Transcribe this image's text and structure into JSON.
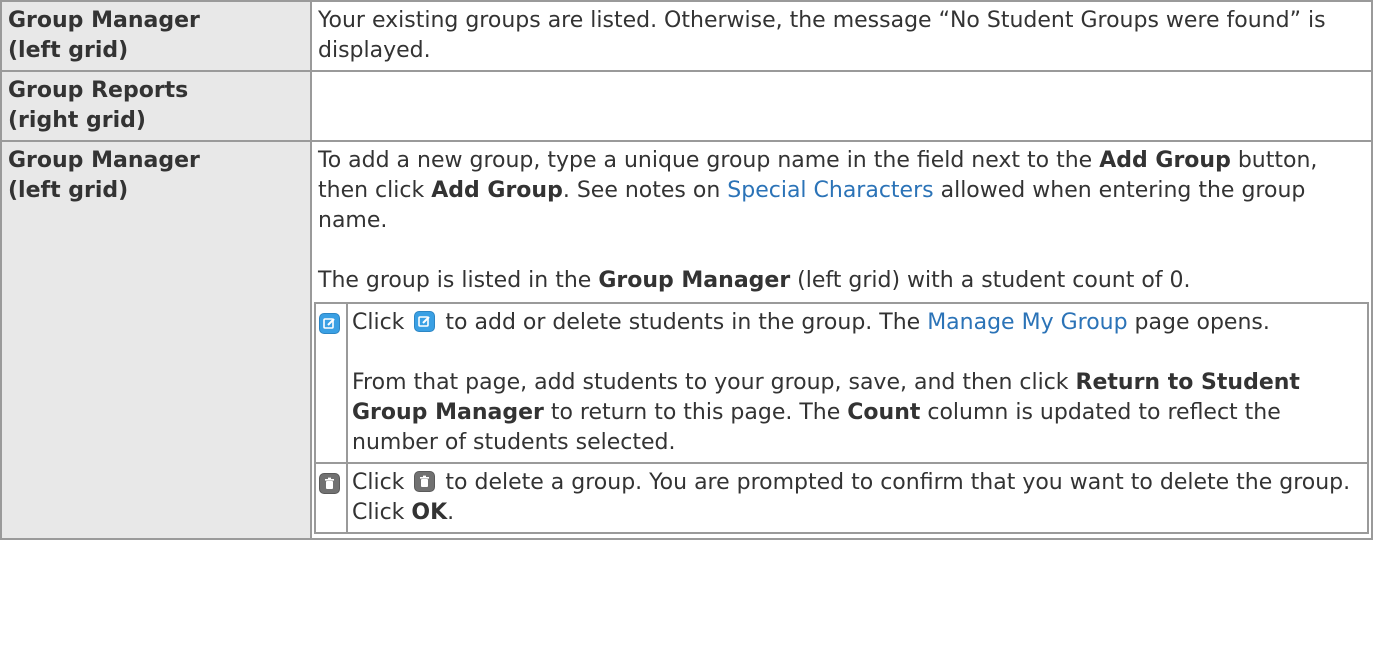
{
  "rows": [
    {
      "header_line1": "Group Manager",
      "header_line2": "(left grid)",
      "text": "Your existing groups are listed. Otherwise, the message “No Student Groups were found” is displayed."
    },
    {
      "header_line1": "Group Reports",
      "header_line2": "(right grid)",
      "text": ""
    },
    {
      "header_line1": "Group Manager",
      "header_line2": "(left grid)",
      "p1": {
        "t1": "To add a new group, type a unique group name in the field next to the ",
        "b1": "Add Group",
        "t2": " button, then click ",
        "b2": "Add Group",
        "t3": ". See notes on ",
        "link": "Special Characters",
        "t4": " allowed when entering the group name."
      },
      "p2": {
        "t1": "The group is listed in the ",
        "b1": "Group Manager",
        "t2": " (left grid) with a student count of 0."
      },
      "sub_rows": {
        "edit": {
          "icon": "edit-icon",
          "t1": "Click ",
          "t2": " to add or delete students in the group. The ",
          "link": "Manage My Group",
          "t3": " page opens.",
          "p2_t1": "From that page, add students to your group, save, and then click ",
          "p2_b1": "Return to Student Group Manager",
          "p2_t2": " to return to this page. The ",
          "p2_b2": "Count",
          "p2_t3": " column is updated to reflect the number of students selected."
        },
        "delete": {
          "icon": "trash-icon",
          "t1": "Click ",
          "t2": " to delete a group. You are prompted to confirm that you want to delete the group. Click ",
          "b1": "OK",
          "t3": "."
        }
      }
    }
  ],
  "colors": {
    "header_bg": "#e8e8e8",
    "border": "#9a9a9a",
    "link": "#2b73b7",
    "edit_icon": "#3aa0e4",
    "trash_icon": "#717171"
  }
}
